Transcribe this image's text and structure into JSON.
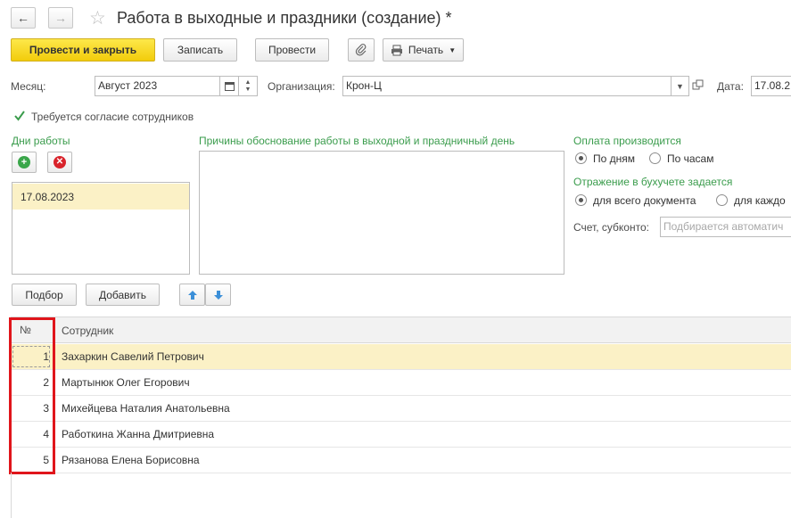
{
  "window": {
    "title": "Работа в выходные и праздники (создание) *"
  },
  "toolbar": {
    "post_close": "Провести и закрыть",
    "save": "Записать",
    "post": "Провести",
    "print": "Печать"
  },
  "form": {
    "month_label": "Месяц:",
    "month_value": "Август 2023",
    "org_label": "Организация:",
    "org_value": "Крон-Ц",
    "date_label": "Дата:",
    "date_value": "17.08.2",
    "consent_label": "Требуется согласие сотрудников",
    "consent_checked": true
  },
  "days": {
    "label": "Дни работы",
    "items": [
      "17.08.2023"
    ]
  },
  "reasons": {
    "label": "Причины обоснование работы в выходной и праздничный день",
    "value": ""
  },
  "payment": {
    "label": "Оплата производится",
    "options": [
      "По дням",
      "По часам"
    ],
    "selected": "По дням"
  },
  "accounting": {
    "label": "Отражение в бухучете задается",
    "options": [
      "для всего документа",
      "для каждо"
    ],
    "selected": "для всего документа",
    "account_label": "Счет, субконто:",
    "account_placeholder": "Подбирается автоматич"
  },
  "table_toolbar": {
    "select": "Подбор",
    "add": "Добавить"
  },
  "table": {
    "columns": [
      "№",
      "Сотрудник"
    ],
    "rows": [
      {
        "n": "1",
        "name": "Захаркин Савелий Петрович"
      },
      {
        "n": "2",
        "name": "Мартынюк Олег Егорович"
      },
      {
        "n": "3",
        "name": "Михейцева Наталия Анатольевна"
      },
      {
        "n": "4",
        "name": "Работкина Жанна Дмитриевна"
      },
      {
        "n": "5",
        "name": "Рязанова Елена Борисовна"
      }
    ],
    "selected_row": 0
  },
  "colors": {
    "accent_green": "#3a9c4c",
    "primary_button": "#f2cc0b",
    "selection": "#fbf1c6",
    "highlight_frame": "#e0151b"
  }
}
